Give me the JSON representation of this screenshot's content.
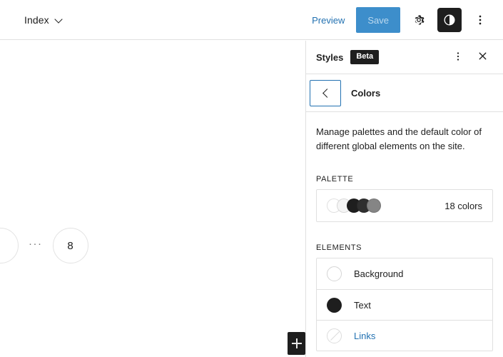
{
  "toolbar": {
    "document_title": "Index",
    "chevron_icon": "chevron-down-icon",
    "preview_label": "Preview",
    "save_label": "Save",
    "settings_icon": "gear-icon",
    "styles_icon": "contrast-icon",
    "more_icon": "more-vertical-icon"
  },
  "canvas": {
    "pagination": {
      "ellipsis": "···",
      "current_page": "8"
    },
    "inserter": {
      "icon": "plus-icon"
    }
  },
  "sidebar": {
    "title": "Styles",
    "badge": "Beta",
    "more_icon": "more-vertical-icon",
    "close_icon": "close-icon",
    "nav": {
      "back_icon": "chevron-left-icon",
      "title": "Colors"
    },
    "description": "Manage palettes and the default color of different global elements on the site.",
    "palette": {
      "section_label": "Palette",
      "count_label": "18 colors",
      "swatches": [
        "#ffffff",
        "#f5f5f5",
        "#1e1e1e",
        "#2f2f2f",
        "#858585"
      ]
    },
    "elements": {
      "section_label": "Elements",
      "items": [
        {
          "label": "Background",
          "swatch": "#ffffff",
          "swatch_style": "empty"
        },
        {
          "label": "Text",
          "swatch": "#1e1e1e",
          "swatch_style": "filled"
        },
        {
          "label": "Links",
          "swatch": "",
          "swatch_style": "slashed"
        }
      ]
    }
  },
  "colors": {
    "accent": "#2271b1",
    "save_bg": "#3d8ecb",
    "dark": "#1e1e1e",
    "border": "#e0e0e0"
  }
}
